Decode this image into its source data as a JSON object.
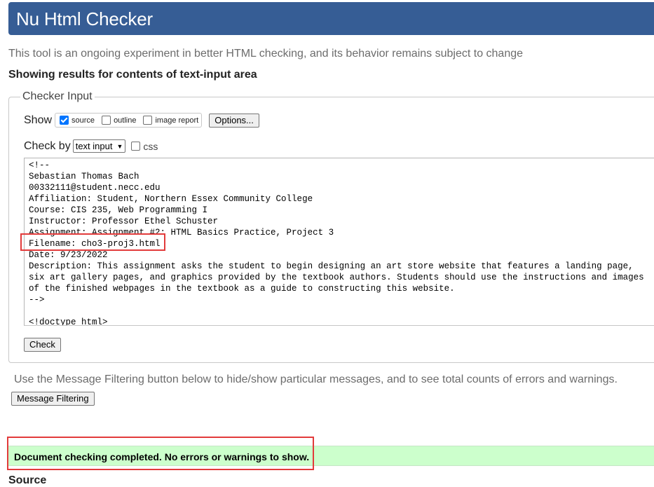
{
  "header": {
    "title": "Nu Html Checker"
  },
  "intro": "This tool is an ongoing experiment in better HTML checking, and its behavior remains subject to change",
  "results_heading": "Showing results for contents of text-input area",
  "checker_input": {
    "legend": "Checker Input",
    "show_label": "Show",
    "options": [
      {
        "label": "source",
        "checked": true
      },
      {
        "label": "outline",
        "checked": false
      },
      {
        "label": "image report",
        "checked": false
      }
    ],
    "options_button": "Options...",
    "check_by_label": "Check by",
    "check_by_value": "text input",
    "css_label": "css",
    "css_checked": false,
    "text_lines": [
      "<!--",
      "Sebastian Thomas Bach",
      "00332111@student.necc.edu",
      "Affiliation: Student, Northern Essex Community College",
      "Course: CIS 235, Web Programming I",
      "Instructor: Professor Ethel Schuster",
      "Assignment: Assignment #2: HTML Basics Practice, Project 3",
      "Filename: cho3-proj3.html",
      "Date: 9/23/2022",
      "Description: This assignment asks the student to begin designing an art store website that features a landing page,",
      "six art gallery pages, and graphics provided by the textbook authors. Students should use the instructions and images",
      "of the finished webpages in the textbook as a guide to constructing this website.",
      "-->",
      "",
      "<!doctype html>"
    ],
    "check_button": "Check"
  },
  "filter_note": "Use the Message Filtering button below to hide/show particular messages, and to see total counts of errors and warnings.",
  "filter_button": "Message Filtering",
  "success_message": "Document checking completed. No errors or warnings to show.",
  "source_heading": "Source",
  "colors": {
    "header_bg": "#365d95",
    "success_bg": "#ccffcc",
    "highlight": "#e23b3b"
  }
}
